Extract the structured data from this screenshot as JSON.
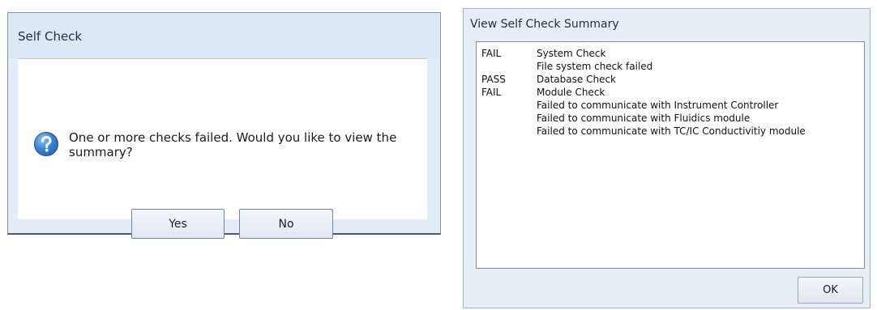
{
  "self_check_dialog": {
    "title": "Self Check",
    "message": "One or more checks failed.  Would you like to view the summary?",
    "yes_label": "Yes",
    "no_label": "No",
    "icon": "question-icon"
  },
  "summary_dialog": {
    "title": "View Self Check Summary",
    "rows": [
      {
        "status": "FAIL",
        "text": "System Check"
      },
      {
        "status": "",
        "text": "File system check failed"
      },
      {
        "status": "PASS",
        "text": "Database Check"
      },
      {
        "status": "FAIL",
        "text": "Module Check"
      },
      {
        "status": "",
        "text": "Failed to communicate with Instrument Controller"
      },
      {
        "status": "",
        "text": "Failed to communicate with Fluidics module"
      },
      {
        "status": "",
        "text": "Failed to communicate with TC/IC Conductivitiy module"
      }
    ],
    "ok_label": "OK"
  }
}
